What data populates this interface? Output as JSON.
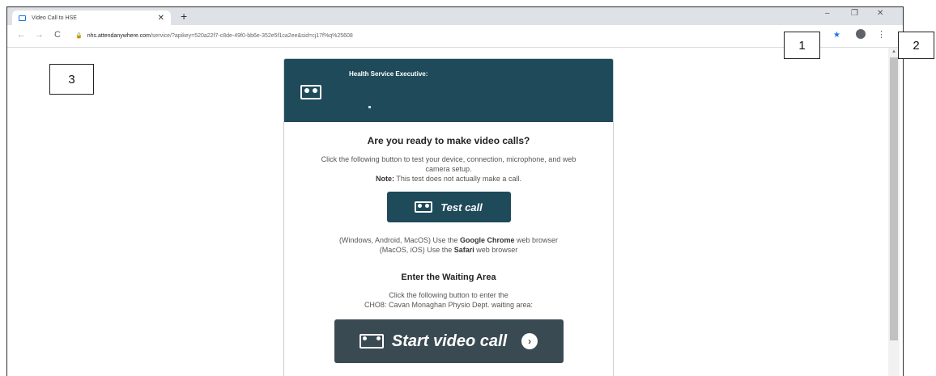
{
  "browser": {
    "tab_title": "Video Call to HSE",
    "tab_close": "✕",
    "new_tab": "+",
    "minimize": "–",
    "restore": "❐",
    "close": "✕",
    "url_host": "nhs.attendanywhere.com",
    "url_path": "/service/?apikey=520a22f7-c8de-49f0-bb6e-352e5f1ca2ee&sid=cj17f%q%25608",
    "back": "←",
    "forward": "→",
    "reload": "C",
    "lock": "🔒",
    "star": "★",
    "kebab": "⋮"
  },
  "card": {
    "org_name": "Health Service Executive:",
    "heading_ready": "Are you ready to make video calls?",
    "test_text": "Click the following button to test your device, connection, microphone, and web camera setup.",
    "note_label": "Note:",
    "note_text": " This test does not actually make a call.",
    "test_button": "Test call",
    "browser_line1_pre": "(Windows, Android, MacOS) Use the ",
    "browser_line1_bold": "Google Chrome",
    "browser_line1_post": " web browser",
    "browser_line2_pre": "(MacOS, iOS) Use the ",
    "browser_line2_bold": "Safari",
    "browser_line2_post": " web browser",
    "heading_waiting": "Enter the Waiting Area",
    "waiting_text1": "Click the following button to enter the",
    "waiting_text2": "CHO8: Cavan Monaghan Physio Dept. waiting area:",
    "start_button": "Start video call",
    "start_arrow": "›"
  },
  "callouts": {
    "c1": "1",
    "c2": "2",
    "c3": "3"
  }
}
